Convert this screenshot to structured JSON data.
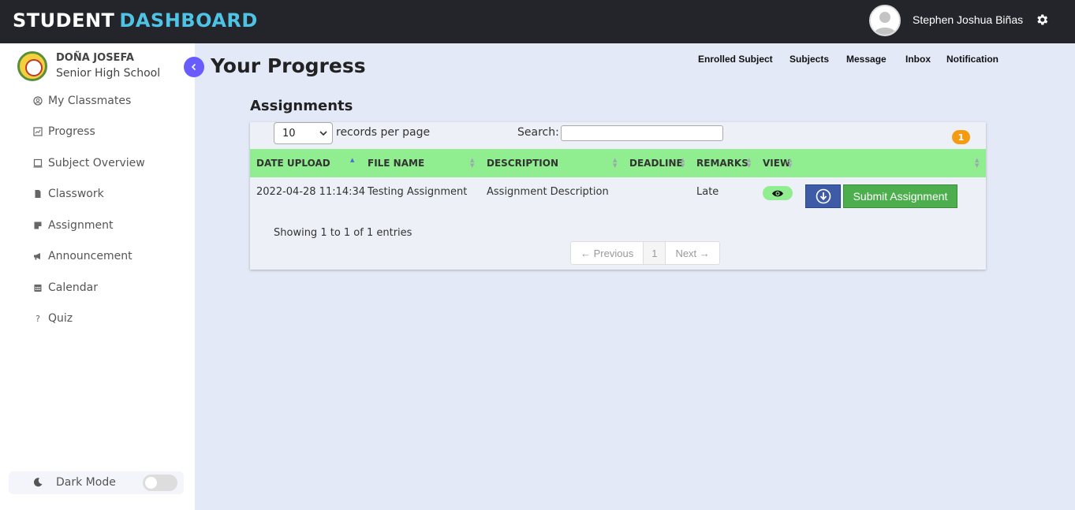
{
  "header": {
    "brand_part1": "STUDENT",
    "brand_part2": "DASHBOARD",
    "user_name": "Stephen Joshua Biñas",
    "settings_icon": "gear-icon"
  },
  "sidebar": {
    "school_line1": "DOÑA JOSEFA",
    "school_line2": "Senior High School",
    "items": [
      {
        "label": "My Classmates",
        "icon": "user-circle-icon"
      },
      {
        "label": "Progress",
        "icon": "chart-icon"
      },
      {
        "label": "Subject Overview",
        "icon": "laptop-icon"
      },
      {
        "label": "Classwork",
        "icon": "file-icon"
      },
      {
        "label": "Assignment",
        "icon": "note-icon"
      },
      {
        "label": "Announcement",
        "icon": "megaphone-icon"
      },
      {
        "label": "Calendar",
        "icon": "calendar-icon"
      },
      {
        "label": "Quiz",
        "icon": "question-icon"
      }
    ],
    "dark_mode_label": "Dark Mode",
    "dark_mode_on": false
  },
  "main": {
    "title": "Your Progress",
    "top_links": [
      "Enrolled Subject",
      "Subjects",
      "Message",
      "Inbox",
      "Notification"
    ],
    "section_title": "Assignments",
    "notification_count": "1",
    "table": {
      "length_value": "10",
      "records_label": "records per page",
      "search_label": "Search:",
      "search_value": "",
      "columns": [
        "DATE UPLOAD",
        "FILE NAME",
        "DESCRIPTION",
        "DEADLINE",
        "REMARKS",
        "VIEW"
      ],
      "rows": [
        {
          "date_upload": "2022-04-28 11:14:34",
          "file_name": "Testing Assignment",
          "description": "Assignment Description",
          "deadline": "",
          "remarks": "Late",
          "submit_label": "Submit Assignment"
        }
      ],
      "info": "Showing 1 to 1 of 1 entries",
      "pagination": {
        "previous": "← Previous",
        "current": "1",
        "next": "Next →"
      }
    }
  },
  "colors": {
    "topbar": "#24252a",
    "brand_accent": "#4ec3e6",
    "table_header": "#90ee90",
    "submit": "#4cae4c",
    "download": "#3e5ba8",
    "badge": "#f39c12",
    "toggle": "#695cfe"
  }
}
